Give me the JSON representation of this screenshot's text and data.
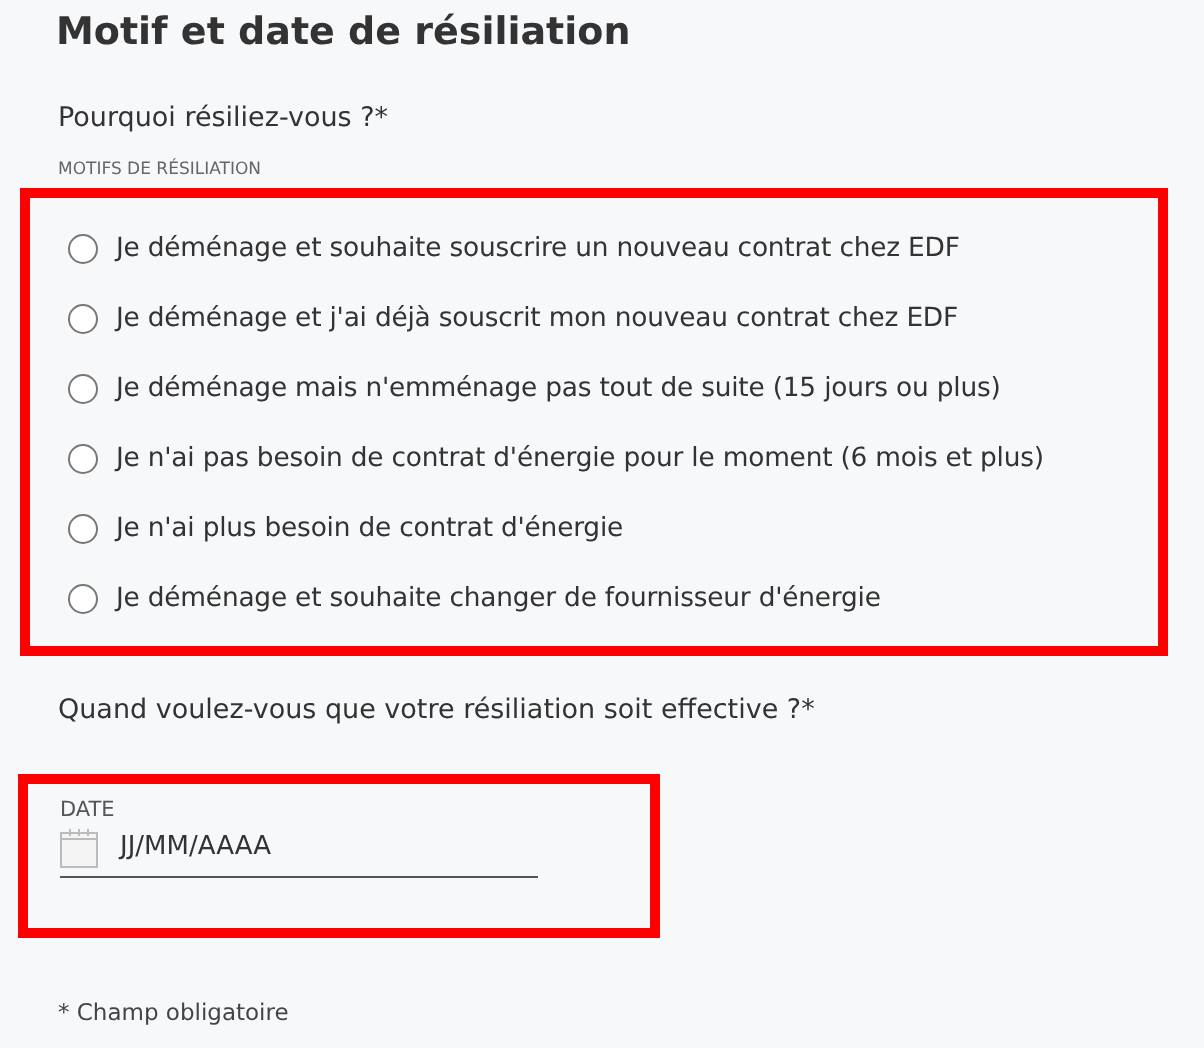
{
  "title": "Motif et date de résiliation",
  "reason": {
    "question": "Pourquoi résiliez-vous ?*",
    "group_label": "MOTIFS DE RÉSILIATION",
    "options": [
      {
        "label": "Je déménage et souhaite souscrire un nouveau contrat chez EDF",
        "selected": false
      },
      {
        "label": "Je déménage et j'ai déjà souscrit mon nouveau contrat chez EDF",
        "selected": false
      },
      {
        "label": "Je déménage mais n'emménage pas tout de suite (15 jours ou plus)",
        "selected": false
      },
      {
        "label": "Je n'ai pas besoin de contrat d'énergie pour le moment (6 mois et plus)",
        "selected": false
      },
      {
        "label": "Je n'ai plus besoin de contrat d'énergie",
        "selected": false
      },
      {
        "label": "Je déménage et souhaite changer de fournisseur d'énergie",
        "selected": false
      }
    ]
  },
  "date": {
    "question": "Quand voulez-vous que votre résiliation soit effective ?*",
    "label": "DATE",
    "value": "JJ/MM/AAAA"
  },
  "footnote": "* Champ obligatoire"
}
